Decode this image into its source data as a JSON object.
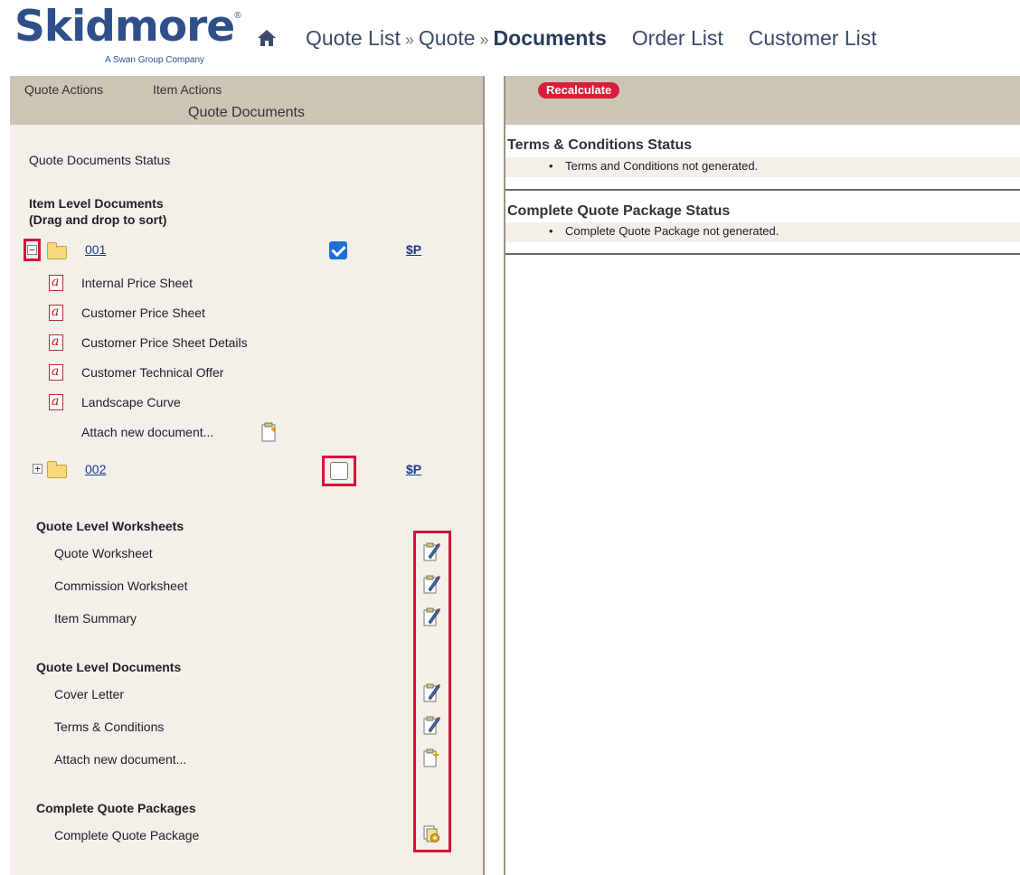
{
  "header": {
    "logo_text": "Skidmore",
    "logo_reg": "®",
    "logo_tagline": "A Swan Group Company",
    "breadcrumb": [
      "Quote List",
      "Quote",
      "Documents"
    ],
    "breadcrumb_sep": "»",
    "nav_links": [
      "Order List",
      "Customer List"
    ]
  },
  "left_panel": {
    "tabs": [
      "Quote Actions",
      "Item Actions"
    ],
    "title": "Quote Documents",
    "status_label": "Quote Documents Status",
    "item_docs_heading": "Item Level Documents",
    "item_docs_subheading": "(Drag and drop to sort)",
    "items": [
      {
        "id": "001",
        "expanded": true,
        "checked": true,
        "price_link": "$P",
        "documents": [
          "Internal Price Sheet",
          "Customer Price Sheet",
          "Customer Price Sheet Details",
          "Customer Technical Offer",
          "Landscape Curve"
        ],
        "attach_label": "Attach new document..."
      },
      {
        "id": "002",
        "expanded": false,
        "checked": false,
        "price_link": "$P"
      }
    ],
    "worksheets_heading": "Quote Level Worksheets",
    "worksheets": [
      "Quote Worksheet",
      "Commission Worksheet",
      "Item Summary"
    ],
    "quote_docs_heading": "Quote Level Documents",
    "quote_docs": [
      "Cover Letter",
      "Terms & Conditions",
      "Attach new document..."
    ],
    "packages_heading": "Complete Quote Packages",
    "packages": [
      "Complete Quote Package"
    ]
  },
  "right_panel": {
    "recalculate_label": "Recalculate",
    "terms_heading": "Terms & Conditions Status",
    "terms_status": "Terms and Conditions not generated.",
    "package_heading": "Complete Quote Package Status",
    "package_status": "Complete Quote Package not generated.",
    "bullet": "•"
  },
  "colors": {
    "brand": "#2f4f8a",
    "highlight": "#d2143c",
    "panel_header": "#ccc5b6",
    "panel_bg": "#f3efe9",
    "checkbox": "#1e6fd8"
  }
}
